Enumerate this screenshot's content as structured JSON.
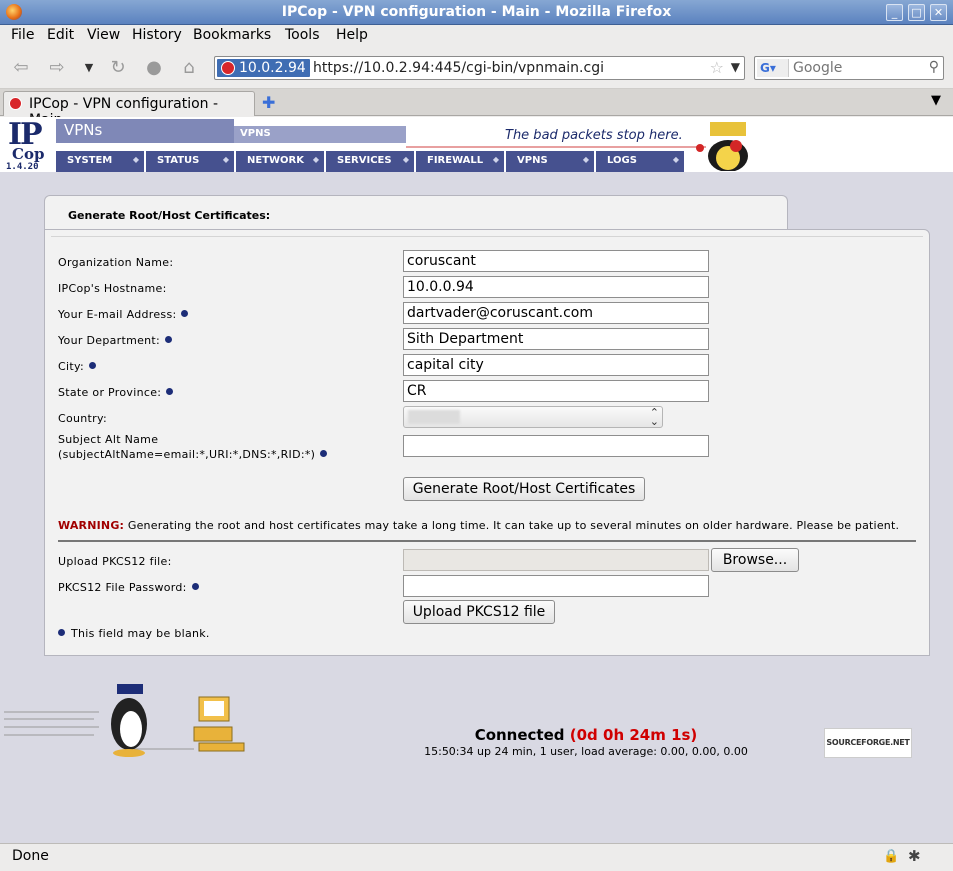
{
  "window": {
    "title": "IPCop - VPN configuration - Main - Mozilla Firefox"
  },
  "menu": [
    "File",
    "Edit",
    "View",
    "History",
    "Bookmarks",
    "Tools",
    "Help"
  ],
  "toolbar": {
    "back_icon": "back-arrow-icon",
    "forward_icon": "forward-arrow-icon",
    "url_host": "10.0.2.94",
    "url": "https://10.0.2.94:445/cgi-bin/vpnmain.cgi",
    "search_placeholder": "Google"
  },
  "tab": {
    "label": "IPCop - VPN configuration - Main"
  },
  "header": {
    "logo_ip": "IP",
    "logo_cop": "Cop",
    "version": "1.4.20",
    "section": "VPNs",
    "subtab": "VPNS",
    "tagline": "The bad packets stop here.",
    "nav": [
      "SYSTEM",
      "STATUS",
      "NETWORK",
      "SERVICES",
      "FIREWALL",
      "VPNS",
      "LOGS"
    ]
  },
  "form": {
    "heading": "Generate Root/Host Certificates:",
    "fields": [
      {
        "label": "Organization Name:",
        "value": "coruscant",
        "optional": false
      },
      {
        "label": "IPCop's Hostname:",
        "value": "10.0.0.94",
        "optional": false
      },
      {
        "label": "Your E-mail Address:",
        "value": "dartvader@coruscant.com",
        "optional": true
      },
      {
        "label": "Your Department:",
        "value": "Sith Department",
        "optional": true
      },
      {
        "label": "City:",
        "value": "capital city",
        "optional": true
      },
      {
        "label": "State or Province:",
        "value": "CR",
        "optional": true
      }
    ],
    "country_label": "Country:",
    "san_label_1": "Subject Alt Name",
    "san_label_2": "(subjectAltName=email:*,URI:*,DNS:*,RID:*)",
    "san_value": "",
    "generate_button": "Generate Root/Host Certificates",
    "warning_label": "WARNING:",
    "warning_text": "Generating the root and host certificates may take a long time. It can take up to several minutes on older hardware. Please be patient.",
    "upload_label": "Upload PKCS12 file:",
    "browse_button": "Browse...",
    "password_label": "PKCS12 File Password:",
    "upload_button": "Upload PKCS12 file",
    "legend": "This field may be blank."
  },
  "footer": {
    "connected_label": "Connected",
    "connected_time": "(0d 0h 24m 1s)",
    "uptime": "15:50:34 up 24 min, 1 user, load average: 0.00, 0.00, 0.00",
    "sourceforge": "SOURCEFORGE.NET"
  },
  "status": {
    "text": "Done"
  }
}
